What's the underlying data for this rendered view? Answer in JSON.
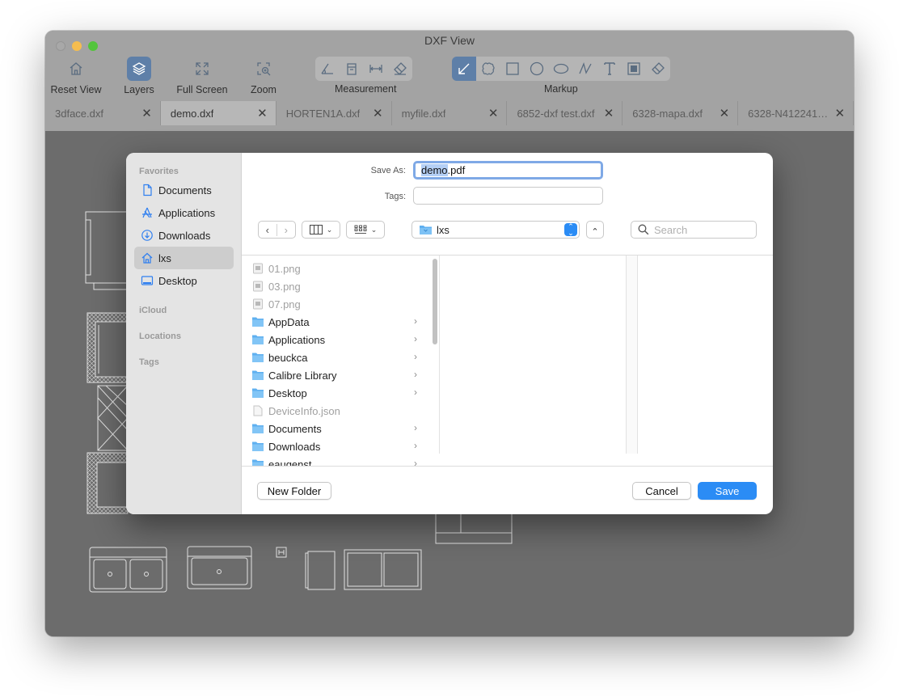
{
  "window": {
    "title": "DXF View"
  },
  "toolbar": {
    "reset_view": "Reset View",
    "layers": "Layers",
    "full_screen": "Full Screen",
    "zoom": "Zoom",
    "measurement": "Measurement",
    "markup": "Markup"
  },
  "tabs": [
    {
      "label": "3dface.dxf"
    },
    {
      "label": "demo.dxf"
    },
    {
      "label": "HORTEN1A.dxf"
    },
    {
      "label": "myfile.dxf"
    },
    {
      "label": "6852-dxf test.dxf"
    },
    {
      "label": "6328-mapa.dxf"
    },
    {
      "label": "6328-N412241…"
    }
  ],
  "tab_close": "✕",
  "dialog": {
    "save_as_label": "Save As:",
    "filename_selected": "demo",
    "filename_ext": ".pdf",
    "tags_label": "Tags:",
    "location": "lxs",
    "search_placeholder": "Search",
    "sidebar": {
      "favorites": "Favorites",
      "items": [
        {
          "label": "Documents",
          "icon": "document-icon"
        },
        {
          "label": "Applications",
          "icon": "applications-icon"
        },
        {
          "label": "Downloads",
          "icon": "download-icon"
        },
        {
          "label": "lxs",
          "icon": "home-icon"
        },
        {
          "label": "Desktop",
          "icon": "desktop-icon"
        }
      ],
      "icloud": "iCloud",
      "locations": "Locations",
      "tags": "Tags"
    },
    "files": [
      {
        "name": "01.png",
        "kind": "image",
        "dim": true,
        "folder": false
      },
      {
        "name": "03.png",
        "kind": "image",
        "dim": true,
        "folder": false
      },
      {
        "name": "07.png",
        "kind": "image",
        "dim": true,
        "folder": false
      },
      {
        "name": "AppData",
        "kind": "folder",
        "dim": false,
        "folder": true
      },
      {
        "name": "Applications",
        "kind": "folder",
        "dim": false,
        "folder": true
      },
      {
        "name": "beuckca",
        "kind": "folder",
        "dim": false,
        "folder": true
      },
      {
        "name": "Calibre Library",
        "kind": "folder",
        "dim": false,
        "folder": true
      },
      {
        "name": "Desktop",
        "kind": "folder",
        "dim": false,
        "folder": true
      },
      {
        "name": "DeviceInfo.json",
        "kind": "file",
        "dim": true,
        "folder": false
      },
      {
        "name": "Documents",
        "kind": "folder",
        "dim": false,
        "folder": true
      },
      {
        "name": "Downloads",
        "kind": "folder",
        "dim": false,
        "folder": true
      },
      {
        "name": "eaugenst",
        "kind": "folder",
        "dim": false,
        "folder": true
      }
    ],
    "new_folder": "New Folder",
    "cancel": "Cancel",
    "save": "Save"
  },
  "colors": {
    "accent": "#2b8cf5",
    "toolbar_active": "#5e7fa8",
    "canvas": "#6c6c6c"
  }
}
